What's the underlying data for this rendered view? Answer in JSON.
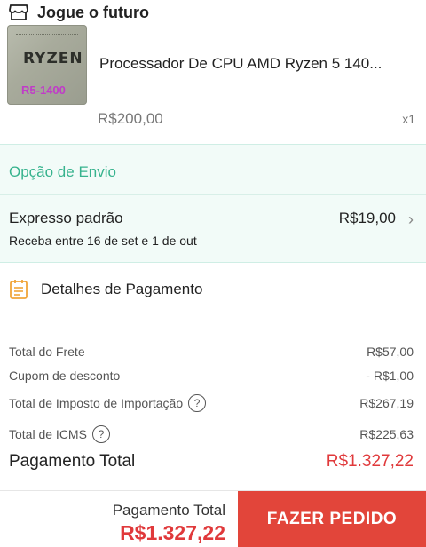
{
  "store": {
    "name": "Jogue o futuro",
    "icon": "store-icon"
  },
  "product": {
    "image_brand": "RYZEN",
    "image_model": "R5-1400",
    "title": "Processador De CPU AMD Ryzen 5 140...",
    "price": "R$200,00",
    "quantity": "x1"
  },
  "shipping": {
    "heading": "Opção de Envio",
    "method": "Expresso padrão",
    "price": "R$19,00",
    "eta": "Receba entre 16 de set e 1 de out",
    "accent_color": "#37b38e"
  },
  "payment": {
    "heading": "Detalhes de Pagamento",
    "icon": "receipt-icon",
    "rows": [
      {
        "label": "Total do Frete",
        "value": "R$57,00"
      },
      {
        "label": "Cupom de desconto",
        "value": "- R$1,00"
      },
      {
        "label": "Total de Imposto de Importação",
        "value": "R$267,19"
      },
      {
        "label": "Total de ICMS",
        "value": "R$225,63"
      }
    ],
    "total_label": "Pagamento Total",
    "total_value": "R$1.327,22"
  },
  "footer": {
    "total_label": "Pagamento Total",
    "total_value": "R$1.327,22",
    "button_label": "FAZER PEDIDO",
    "button_color": "#e2453a"
  }
}
